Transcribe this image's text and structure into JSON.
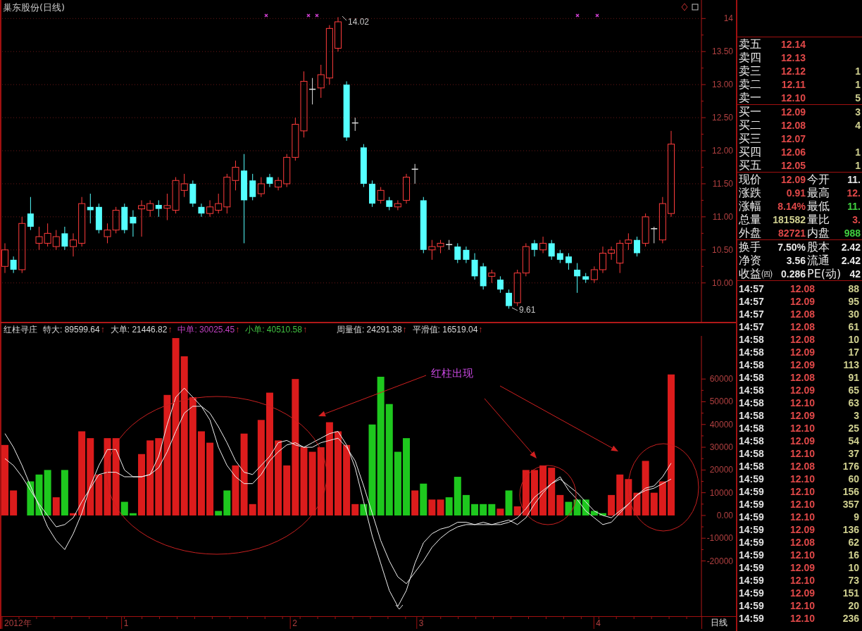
{
  "chart_title": "巢东股份(日线)",
  "price_chart": {
    "high_label": "14.02",
    "low_label": "9.61",
    "chart_data": {
      "type": "candlestick",
      "grid": true,
      "categories": [
        null,
        null,
        null,
        null,
        null,
        null,
        null,
        null,
        null,
        null,
        null,
        null,
        null,
        null,
        null,
        null,
        null,
        null,
        null,
        null,
        null,
        null,
        null,
        null,
        null,
        null,
        null,
        null,
        null,
        null,
        null,
        null,
        null,
        null,
        null,
        null,
        null,
        null,
        null,
        null,
        null,
        null,
        null,
        null,
        null,
        null,
        null,
        null,
        null,
        null,
        null,
        null,
        null,
        null,
        null,
        null,
        null,
        null,
        null,
        null,
        null,
        null,
        null,
        null,
        null,
        null,
        null,
        null,
        null,
        null,
        null,
        null,
        null,
        null,
        null,
        null,
        null,
        null,
        null
      ],
      "ylim": [
        9.39,
        14.28
      ],
      "yticks": [
        {
          "value": 14,
          "label": "14"
        },
        {
          "value": 13.5,
          "label": "13.50"
        },
        {
          "value": 13,
          "label": "13.00"
        },
        {
          "value": 12.5,
          "label": "12.50"
        },
        {
          "value": 12,
          "label": "12.00"
        },
        {
          "value": 11.5,
          "label": "11.50"
        },
        {
          "value": 11,
          "label": "11.00"
        },
        {
          "value": 10.5,
          "label": "10.50"
        },
        {
          "value": 10,
          "label": "10.00"
        }
      ],
      "ohlc": [
        [
          10.25,
          10.6,
          10.15,
          10.5
        ],
        [
          10.35,
          10.4,
          10.15,
          10.2
        ],
        [
          10.2,
          11.0,
          10.15,
          10.9
        ],
        [
          11.05,
          11.3,
          10.8,
          10.85
        ],
        [
          10.6,
          10.85,
          10.5,
          10.7
        ],
        [
          10.6,
          10.9,
          10.55,
          10.75
        ],
        [
          10.55,
          10.8,
          10.5,
          10.7
        ],
        [
          10.75,
          10.85,
          10.5,
          10.55
        ],
        [
          10.55,
          10.75,
          10.4,
          10.65
        ],
        [
          10.6,
          11.3,
          10.55,
          11.2
        ],
        [
          11.15,
          11.35,
          10.9,
          11.1
        ],
        [
          11.15,
          11.2,
          10.75,
          10.8
        ],
        [
          10.7,
          10.9,
          10.6,
          10.8
        ],
        [
          10.8,
          11.15,
          10.75,
          11.1
        ],
        [
          11.15,
          11.2,
          10.75,
          10.8
        ],
        [
          11.0,
          11.1,
          10.7,
          10.9
        ],
        [
          11.12,
          11.25,
          10.7,
          11.17
        ],
        [
          11.1,
          11.25,
          11.0,
          11.2
        ],
        [
          11.18,
          11.25,
          11.0,
          11.12
        ],
        [
          11.13,
          11.35,
          10.95,
          11.17
        ],
        [
          11.1,
          11.6,
          11.05,
          11.55
        ],
        [
          11.4,
          11.65,
          11.3,
          11.5
        ],
        [
          11.5,
          11.55,
          11.15,
          11.2
        ],
        [
          11.15,
          11.2,
          11.0,
          11.05
        ],
        [
          11.05,
          11.25,
          11.0,
          11.15
        ],
        [
          11.1,
          11.35,
          11.05,
          11.2
        ],
        [
          11.15,
          11.65,
          11.05,
          11.6
        ],
        [
          11.55,
          11.85,
          11.4,
          11.75
        ],
        [
          11.7,
          11.95,
          10.6,
          11.25
        ],
        [
          11.55,
          11.65,
          11.25,
          11.3
        ],
        [
          11.35,
          11.6,
          11.3,
          11.5
        ],
        [
          11.6,
          11.65,
          11.45,
          11.5
        ],
        [
          11.45,
          11.6,
          11.4,
          11.55
        ],
        [
          11.5,
          11.95,
          11.45,
          11.9
        ],
        [
          11.9,
          12.5,
          11.85,
          12.4
        ],
        [
          12.3,
          13.2,
          12.2,
          13.05
        ],
        [
          12.93,
          13.1,
          12.7,
          12.93
        ],
        [
          12.95,
          13.3,
          12.8,
          13.15
        ],
        [
          13.1,
          13.9,
          13.0,
          13.85
        ],
        [
          13.55,
          14.02,
          13.5,
          13.95
        ],
        [
          13.0,
          13.05,
          12.15,
          12.2
        ],
        [
          12.42,
          12.5,
          12.3,
          12.42
        ],
        [
          12.05,
          12.1,
          11.45,
          11.5
        ],
        [
          11.5,
          11.55,
          11.15,
          11.2
        ],
        [
          11.25,
          11.45,
          11.2,
          11.4
        ],
        [
          11.25,
          11.3,
          11.1,
          11.15
        ],
        [
          11.15,
          11.25,
          11.1,
          11.2
        ],
        [
          11.25,
          11.65,
          11.2,
          11.6
        ],
        [
          11.72,
          11.8,
          11.5,
          11.72
        ],
        [
          11.25,
          11.3,
          10.45,
          10.5
        ],
        [
          10.5,
          10.65,
          10.35,
          10.55
        ],
        [
          10.55,
          10.65,
          10.45,
          10.6
        ],
        [
          10.58,
          10.65,
          10.5,
          10.58
        ],
        [
          10.55,
          10.6,
          10.3,
          10.35
        ],
        [
          10.5,
          10.55,
          10.3,
          10.35
        ],
        [
          10.35,
          10.45,
          10.05,
          10.1
        ],
        [
          10.25,
          10.3,
          9.9,
          9.95
        ],
        [
          10.1,
          10.2,
          10.0,
          10.15
        ],
        [
          10.05,
          10.1,
          9.85,
          9.9
        ],
        [
          9.85,
          9.9,
          9.61,
          9.65
        ],
        [
          9.7,
          10.2,
          9.65,
          10.15
        ],
        [
          10.15,
          10.6,
          10.1,
          10.55
        ],
        [
          10.6,
          10.65,
          10.4,
          10.5
        ],
        [
          10.5,
          10.7,
          10.45,
          10.6
        ],
        [
          10.6,
          10.65,
          10.35,
          10.4
        ],
        [
          10.45,
          10.5,
          10.3,
          10.35
        ],
        [
          10.4,
          10.45,
          10.2,
          10.3
        ],
        [
          10.2,
          10.3,
          9.85,
          10.1
        ],
        [
          10.1,
          10.15,
          10.0,
          10.05
        ],
        [
          10.05,
          10.25,
          10.0,
          10.2
        ],
        [
          10.2,
          10.55,
          10.15,
          10.45
        ],
        [
          10.45,
          10.55,
          10.35,
          10.5
        ],
        [
          10.3,
          10.65,
          10.15,
          10.6
        ],
        [
          10.6,
          10.75,
          10.5,
          10.65
        ],
        [
          10.65,
          10.7,
          10.4,
          10.45
        ],
        [
          10.6,
          11.05,
          10.55,
          11.0
        ],
        [
          10.82,
          10.85,
          10.6,
          10.82
        ],
        [
          10.65,
          11.3,
          10.6,
          11.2
        ],
        [
          11.05,
          12.3,
          11.0,
          12.1
        ]
      ]
    }
  },
  "indicator": {
    "name": "红柱寻庄",
    "readings": [
      {
        "label": "特大:",
        "value": "89599.64",
        "color": "#d8d8d8",
        "arrow": "↑"
      },
      {
        "label": "大单:",
        "value": "21446.82",
        "color": "#d8d8d8",
        "arrow": "↑"
      },
      {
        "label": "中单:",
        "value": "30025.45",
        "color": "#c040c0",
        "arrow": "↑"
      },
      {
        "label": "小单:",
        "value": "40510.58",
        "color": "#40c040",
        "arrow": "↑"
      },
      {
        "label": "周量值:",
        "value": "24291.38",
        "color": "#d8d8d8",
        "arrow": "↑"
      },
      {
        "label": "平滑值:",
        "value": "16519.04",
        "color": "#d8d8d8",
        "arrow": "↑"
      }
    ],
    "annotation": "红柱出现",
    "chart_data": {
      "type": "bar",
      "categories": [
        null,
        null,
        null,
        null,
        null,
        null,
        null,
        null,
        null,
        null,
        null,
        null,
        null,
        null,
        null,
        null,
        null,
        null,
        null,
        null,
        null,
        null,
        null,
        null,
        null,
        null,
        null,
        null,
        null,
        null,
        null,
        null,
        null,
        null,
        null,
        null,
        null,
        null,
        null,
        null,
        null,
        null,
        null,
        null,
        null,
        null,
        null,
        null,
        null,
        null,
        null,
        null,
        null,
        null,
        null,
        null,
        null,
        null,
        null,
        null,
        null,
        null,
        null,
        null,
        null,
        null,
        null,
        null,
        null,
        null,
        null,
        null,
        null,
        null,
        null,
        null,
        null,
        null,
        null
      ],
      "ylim": [
        -44300,
        78950
      ],
      "yticks": [
        {
          "value": 60000,
          "label": "60000"
        },
        {
          "value": 50000,
          "label": "50000"
        },
        {
          "value": 40000,
          "label": "40000"
        },
        {
          "value": 30000,
          "label": "30000"
        },
        {
          "value": 20000,
          "label": "20000"
        },
        {
          "value": 10000,
          "label": "10000"
        },
        {
          "value": 0,
          "label": "0.00"
        },
        {
          "value": -10000,
          "label": "-10000"
        },
        {
          "value": -20000,
          "label": "-20000"
        }
      ],
      "series": [
        {
          "color": "#dc1c1c",
          "values": [
            31000,
            11000,
            null,
            null,
            null,
            null,
            8000,
            null,
            1000,
            37000,
            34000,
            18000,
            34000,
            34000,
            null,
            null,
            27000,
            33000,
            34000,
            53000,
            78000,
            70000,
            52000,
            37000,
            32000,
            null,
            null,
            22000,
            36000,
            5000,
            42000,
            54000,
            33000,
            22000,
            60000,
            30000,
            28000,
            30000,
            41000,
            37000,
            31000,
            5000,
            null,
            null,
            null,
            null,
            null,
            null,
            11000,
            null,
            7000,
            7000,
            null,
            null,
            null,
            null,
            null,
            null,
            3000,
            null,
            4000,
            20000,
            20000,
            22000,
            21000,
            9000,
            null,
            null,
            null,
            null,
            null,
            9000,
            18000,
            16000,
            10000,
            24000,
            10000,
            15000,
            62000
          ]
        },
        {
          "color": "#1ec81e",
          "values": [
            null,
            null,
            null,
            15000,
            18000,
            20000,
            null,
            20000,
            null,
            null,
            null,
            null,
            null,
            null,
            6000,
            1000,
            null,
            null,
            null,
            null,
            null,
            null,
            null,
            null,
            null,
            2000,
            11000,
            null,
            null,
            null,
            null,
            null,
            null,
            null,
            null,
            null,
            null,
            null,
            null,
            null,
            null,
            null,
            5000,
            40000,
            61000,
            49000,
            28000,
            34000,
            null,
            14000,
            null,
            null,
            8000,
            17000,
            9000,
            5000,
            5000,
            5000,
            null,
            11000,
            null,
            null,
            null,
            null,
            null,
            null,
            6000,
            7000,
            7000,
            2000,
            1000,
            null,
            null,
            null,
            null,
            null,
            null,
            null,
            null
          ]
        },
        {
          "type": "line",
          "color": "#f0f0f0",
          "values": [
            36000,
            30000,
            22000,
            13000,
            4000,
            -5000,
            -11000,
            -15000,
            -8000,
            1000,
            13000,
            22000,
            29000,
            29000,
            20000,
            17000,
            17000,
            18000,
            26000,
            40000,
            52000,
            56000,
            52000,
            48000,
            42000,
            30000,
            22000,
            17000,
            14000,
            14000,
            18000,
            24000,
            28000,
            31000,
            32000,
            30000,
            32000,
            34000,
            36000,
            37000,
            31000,
            21000,
            6000,
            -9000,
            -21000,
            -33000,
            -40000,
            -33000,
            -21000,
            -12000,
            -8000,
            -6000,
            -5000,
            -3000,
            -3000,
            -4000,
            -3000,
            -4000,
            -3000,
            -2000,
            -4000,
            -1000,
            5000,
            10000,
            14000,
            17000,
            11000,
            7000,
            2000,
            -1000,
            -4000,
            -3000,
            1000,
            5000,
            9000,
            12000,
            13000,
            17000,
            23000
          ]
        },
        {
          "type": "line",
          "color": "#f0f0f0",
          "values": [
            25000,
            22000,
            17000,
            11000,
            5000,
            0,
            -5000,
            -4000,
            -1000,
            6000,
            12000,
            18000,
            19000,
            19000,
            17000,
            17000,
            17000,
            18000,
            21000,
            28000,
            37000,
            45000,
            48000,
            48000,
            45000,
            39000,
            32000,
            24000,
            19000,
            18000,
            22000,
            26000,
            32000,
            33000,
            31000,
            30000,
            30000,
            32000,
            33000,
            34000,
            30000,
            24000,
            13000,
            1000,
            -11000,
            -20000,
            -27000,
            -30000,
            -25000,
            -20000,
            -14000,
            -10000,
            -7000,
            -5000,
            -4000,
            -4000,
            -4000,
            -4000,
            -4000,
            -3000,
            -1000,
            3000,
            8000,
            11000,
            14000,
            16000,
            13000,
            10000,
            6000,
            2000,
            0,
            -1000,
            2000,
            5000,
            9000,
            11000,
            12000,
            14000,
            16000
          ]
        }
      ]
    }
  },
  "time_axis": {
    "labels": [
      "2012年",
      "1",
      "2",
      "3",
      "4"
    ],
    "period": "日线"
  },
  "order_book": {
    "asks": [
      {
        "label": "卖五",
        "price": "12.14"
      },
      {
        "label": "卖四",
        "price": "12.13"
      },
      {
        "label": "卖三",
        "price": "12.12",
        "volume": "1"
      },
      {
        "label": "卖二",
        "price": "12.11",
        "volume": "1"
      },
      {
        "label": "卖一",
        "price": "12.10",
        "volume": "5"
      }
    ],
    "bids": [
      {
        "label": "买一",
        "price": "12.09",
        "volume": "3"
      },
      {
        "label": "买二",
        "price": "12.08",
        "volume": "4"
      },
      {
        "label": "买三",
        "price": "12.07"
      },
      {
        "label": "买四",
        "price": "12.06",
        "volume": "1"
      },
      {
        "label": "买五",
        "price": "12.05",
        "volume": "1"
      }
    ]
  },
  "quote": [
    [
      {
        "label": "现价",
        "value": "12.09",
        "color": "#e04848"
      },
      {
        "label": "今开",
        "value": "11.",
        "color": "#e8e8e8"
      }
    ],
    [
      {
        "label": "涨跌",
        "value": "0.91",
        "color": "#e04848"
      },
      {
        "label": "最高",
        "value": "12.",
        "color": "#e04848"
      }
    ],
    [
      {
        "label": "涨幅",
        "value": "8.14%",
        "color": "#e04848"
      },
      {
        "label": "最低",
        "value": "11.",
        "color": "#40d040"
      }
    ],
    [
      {
        "label": "总量",
        "value": "181582",
        "color": "#d0d090"
      },
      {
        "label": "量比",
        "value": "3.",
        "color": "#e04848"
      }
    ],
    [
      {
        "label": "外盘",
        "value": "82721",
        "color": "#e04848"
      },
      {
        "label": "内盘",
        "value": "988",
        "color": "#40d040"
      }
    ]
  ],
  "info": [
    [
      {
        "label": "换手",
        "value": "7.50%"
      },
      {
        "label": "股本",
        "value": "2.42"
      }
    ],
    [
      {
        "label": "净资",
        "value": "3.56"
      },
      {
        "label": "流通",
        "value": "2.42"
      }
    ],
    [
      {
        "label": "收益㈣",
        "value": "0.286"
      },
      {
        "label": "PE(动)",
        "value": "42"
      }
    ]
  ],
  "ticks": [
    {
      "time": "14:57",
      "price": "12.08",
      "volume": "88"
    },
    {
      "time": "14:57",
      "price": "12.09",
      "volume": "95"
    },
    {
      "time": "14:57",
      "price": "12.08",
      "volume": "30"
    },
    {
      "time": "14:57",
      "price": "12.08",
      "volume": "61"
    },
    {
      "time": "14:58",
      "price": "12.08",
      "volume": "10"
    },
    {
      "time": "14:58",
      "price": "12.09",
      "volume": "17"
    },
    {
      "time": "14:58",
      "price": "12.09",
      "volume": "113"
    },
    {
      "time": "14:58",
      "price": "12.08",
      "volume": "91"
    },
    {
      "time": "14:58",
      "price": "12.09",
      "volume": "65"
    },
    {
      "time": "14:58",
      "price": "12.10",
      "volume": "63"
    },
    {
      "time": "14:58",
      "price": "12.09",
      "volume": "3"
    },
    {
      "time": "14:58",
      "price": "12.10",
      "volume": "25"
    },
    {
      "time": "14:58",
      "price": "12.09",
      "volume": "54"
    },
    {
      "time": "14:58",
      "price": "12.10",
      "volume": "37"
    },
    {
      "time": "14:58",
      "price": "12.08",
      "volume": "176"
    },
    {
      "time": "14:59",
      "price": "12.10",
      "volume": "60"
    },
    {
      "time": "14:59",
      "price": "12.10",
      "volume": "156"
    },
    {
      "time": "14:59",
      "price": "12.10",
      "volume": "357"
    },
    {
      "time": "14:59",
      "price": "12.10",
      "volume": "9"
    },
    {
      "time": "14:59",
      "price": "12.09",
      "volume": "136"
    },
    {
      "time": "14:59",
      "price": "12.08",
      "volume": "62"
    },
    {
      "time": "14:59",
      "price": "12.10",
      "volume": "16"
    },
    {
      "time": "14:59",
      "price": "12.09",
      "volume": "10"
    },
    {
      "time": "14:59",
      "price": "12.10",
      "volume": "73"
    },
    {
      "time": "14:59",
      "price": "12.09",
      "volume": "151"
    },
    {
      "time": "14:59",
      "price": "12.10",
      "volume": "20"
    },
    {
      "time": "14:59",
      "price": "12.10",
      "volume": "236"
    }
  ]
}
